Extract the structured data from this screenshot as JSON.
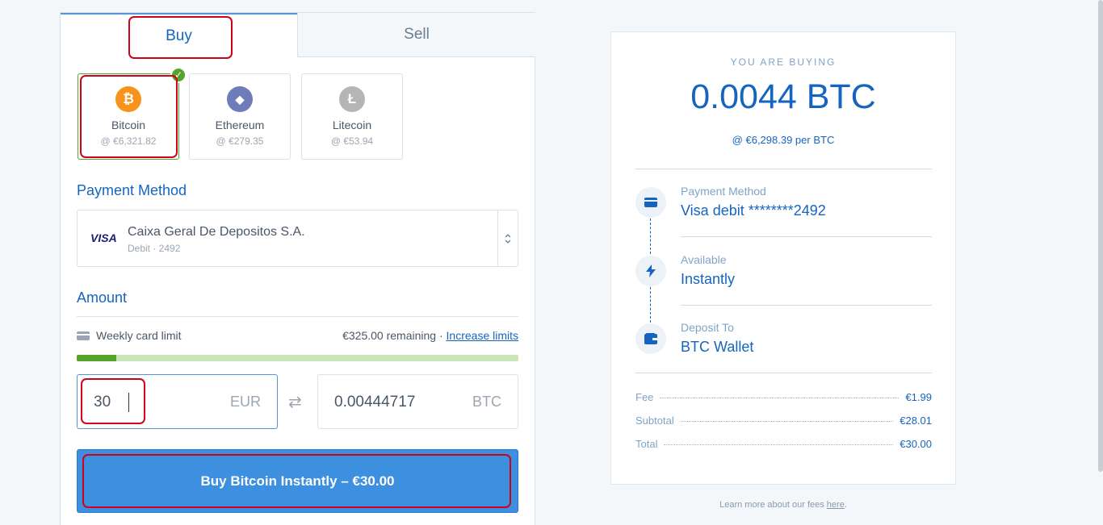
{
  "tabs": {
    "buy": "Buy",
    "sell": "Sell"
  },
  "coins": [
    {
      "name": "Bitcoin",
      "price": "@ €6,321.82",
      "color": "#f7931a",
      "icon": "bitcoin-icon",
      "symbol": "₿"
    },
    {
      "name": "Ethereum",
      "price": "@ €279.35",
      "color": "#6f7cba",
      "icon": "ethereum-icon",
      "symbol": "◆"
    },
    {
      "name": "Litecoin",
      "price": "@ €53.94",
      "color": "#b5b5b5",
      "icon": "litecoin-icon",
      "symbol": "Ł"
    }
  ],
  "payment": {
    "title": "Payment Method",
    "brand": "VISA",
    "bank": "Caixa Geral De Depositos S.A.",
    "sub": "Debit · 2492"
  },
  "amount": {
    "title": "Amount",
    "limit_label": "Weekly card limit",
    "remaining": "€325.00 remaining",
    "separator": "·",
    "increase_link": "Increase limits",
    "progress_fraction": 0.09,
    "fiat_value": "30",
    "fiat_currency": "EUR",
    "crypto_value": "0.00444717",
    "crypto_currency": "BTC"
  },
  "buy_button": "Buy Bitcoin Instantly – €30.00",
  "summary": {
    "heading": "YOU ARE BUYING",
    "amount": "0.0044 BTC",
    "per_price": "@ €6,298.39 per BTC",
    "steps": [
      {
        "label": "Payment Method",
        "value": "Visa debit ********2492",
        "icon": "credit-card-icon"
      },
      {
        "label": "Available",
        "value": "Instantly",
        "icon": "lightning-icon"
      },
      {
        "label": "Deposit To",
        "value": "BTC Wallet",
        "icon": "wallet-icon"
      }
    ],
    "fees": [
      {
        "label": "Fee",
        "value": "€1.99"
      },
      {
        "label": "Subtotal",
        "value": "€28.01"
      },
      {
        "label": "Total",
        "value": "€30.00"
      }
    ]
  },
  "footer": {
    "text": "Learn more about our fees ",
    "link": "here",
    "end": "."
  },
  "colors": {
    "accent": "#1565c0",
    "button": "#3d8fe0",
    "success": "#56a329",
    "annotation": "#d0021b"
  }
}
